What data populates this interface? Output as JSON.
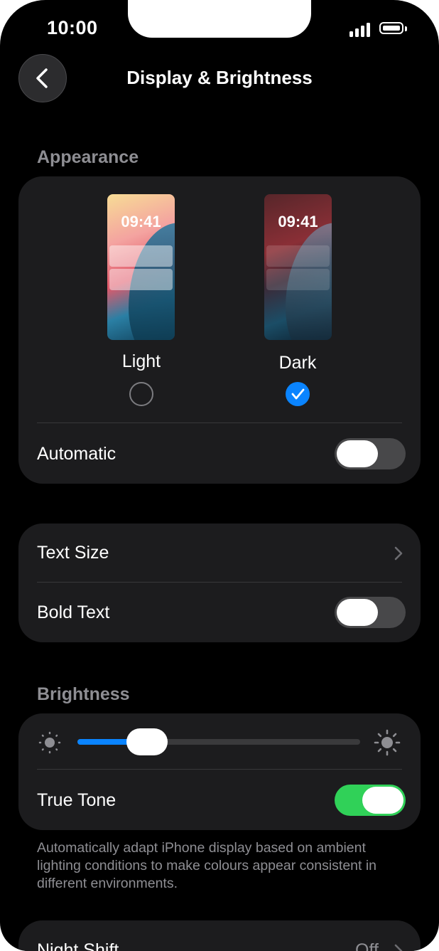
{
  "status": {
    "time": "10:00"
  },
  "nav": {
    "title": "Display & Brightness"
  },
  "appearance": {
    "label": "Appearance",
    "preview_time": "09:41",
    "light_label": "Light",
    "dark_label": "Dark",
    "selected": "Dark",
    "automatic_label": "Automatic",
    "automatic_on": false
  },
  "text_settings": {
    "text_size_label": "Text Size",
    "bold_text_label": "Bold Text",
    "bold_text_on": false
  },
  "brightness": {
    "label": "Brightness",
    "level": 0.245,
    "true_tone_label": "True Tone",
    "true_tone_on": true,
    "footnote": "Automatically adapt iPhone display based on ambient lighting conditions to make colours appear consistent in different environments."
  },
  "night_shift": {
    "label": "Night Shift",
    "value": "Off"
  },
  "colors": {
    "accent": "#0a84ff",
    "switch_on": "#30d158",
    "card": "#1c1c1e",
    "secondary_text": "#8e8e93"
  }
}
